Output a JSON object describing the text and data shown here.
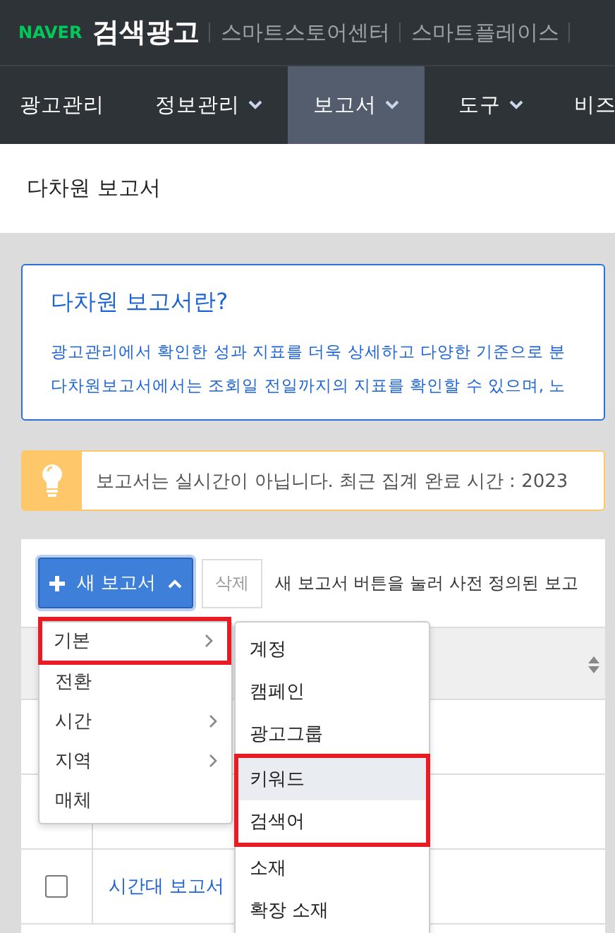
{
  "header": {
    "logo_brand": "NAVER",
    "logo_product": "검색광고",
    "links": [
      "스마트스토어센터",
      "스마트플레이스"
    ]
  },
  "nav": [
    {
      "label": "광고관리",
      "dropdown": false,
      "selected": false
    },
    {
      "label": "정보관리",
      "dropdown": true,
      "selected": false
    },
    {
      "label": "보고서",
      "dropdown": true,
      "selected": true
    },
    {
      "label": "도구",
      "dropdown": true,
      "selected": false
    },
    {
      "label": "비즈",
      "dropdown": false,
      "selected": false
    }
  ],
  "page_title": "다차원 보고서",
  "info": {
    "title": "다차원 보고서란?",
    "lines": [
      "광고관리에서 확인한 성과 지표를 더욱 상세하고 다양한 기준으로 분",
      "다차원보고서에서는 조회일 전일까지의 지표를 확인할 수 있으며, 노"
    ]
  },
  "notice": {
    "text": "보고서는 실시간이 아닙니다. 최근 집계 완료 시간 : 2023"
  },
  "toolbar": {
    "new_button": "새 보고서",
    "delete_button": "삭제",
    "hint": "새 보고서 버튼을 눌러 사전 정의된 보고"
  },
  "table": {
    "rows": [
      {
        "checked": false,
        "name": "시간대 보고서"
      }
    ]
  },
  "menu": {
    "items": [
      {
        "label": "기본",
        "submenu": true,
        "highlighted": true
      },
      {
        "label": "전환",
        "submenu": false,
        "highlighted": false
      },
      {
        "label": "시간",
        "submenu": true,
        "highlighted": false
      },
      {
        "label": "지역",
        "submenu": true,
        "highlighted": false
      },
      {
        "label": "매체",
        "submenu": false,
        "highlighted": false
      }
    ]
  },
  "submenu": {
    "items": [
      {
        "label": "계정",
        "hovered": false,
        "highlighted": false
      },
      {
        "label": "캠페인",
        "hovered": false,
        "highlighted": false
      },
      {
        "label": "광고그룹",
        "hovered": false,
        "highlighted": false
      },
      {
        "label": "키워드",
        "hovered": true,
        "highlighted": true
      },
      {
        "label": "검색어",
        "hovered": false,
        "highlighted": true
      },
      {
        "label": "소재",
        "hovered": false,
        "highlighted": false
      },
      {
        "label": "확장 소재",
        "hovered": false,
        "highlighted": false
      }
    ]
  }
}
